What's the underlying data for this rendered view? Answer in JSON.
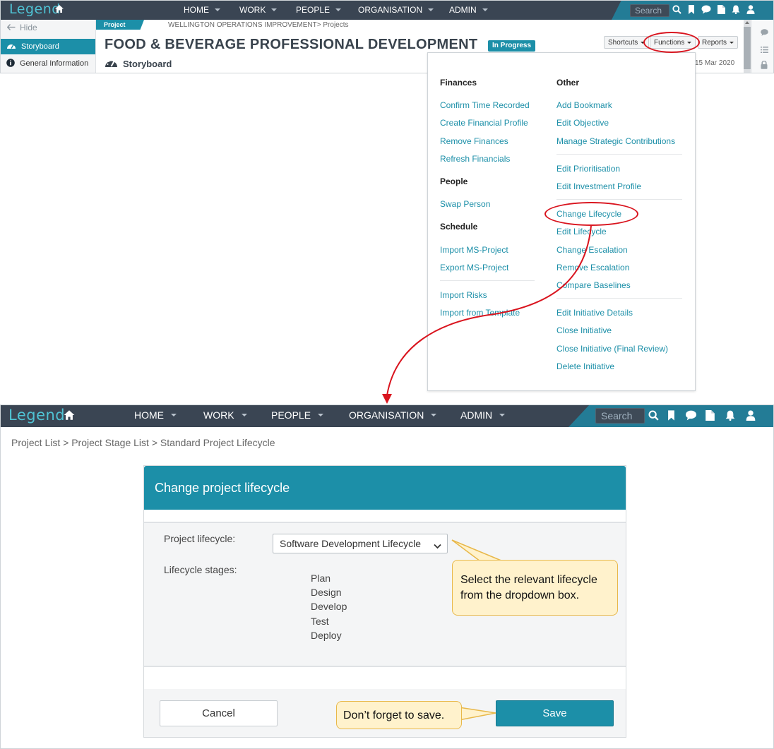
{
  "nav_top": {
    "logo": "Legend",
    "menu": [
      {
        "label": "HOME"
      },
      {
        "label": "WORK"
      },
      {
        "label": "PEOPLE"
      },
      {
        "label": "ORGANISATION"
      },
      {
        "label": "ADMIN"
      }
    ],
    "search_placeholder": "Search"
  },
  "sidebar": {
    "hide_label": "Hide",
    "items": [
      {
        "label": "Storyboard",
        "active": true
      },
      {
        "label": "General Information",
        "active": false
      }
    ]
  },
  "header": {
    "tag": "Project",
    "breadcrumb": "WELLINGTON OPERATIONS IMPROVEMENT> Projects",
    "title": "FOOD & BEVERAGE PROFESSIONAL DEVELOPMENT",
    "status": "In Progress",
    "subtitle": "Storyboard",
    "buttons": {
      "shortcuts": "Shortcuts",
      "functions": "Functions",
      "reports": "Reports"
    },
    "date": "15 Mar 2020"
  },
  "functions_menu": {
    "col_left": {
      "finances_heading": "Finances",
      "finances": [
        "Confirm Time Recorded",
        "Create Financial Profile",
        "Remove Finances",
        "Refresh Financials"
      ],
      "people_heading": "People",
      "people": [
        "Swap Person"
      ],
      "schedule_heading": "Schedule",
      "schedule": [
        "Import MS-Project",
        "Export MS-Project"
      ],
      "misc": [
        "Import Risks",
        "Import from Template"
      ]
    },
    "col_right": {
      "other_heading": "Other",
      "group1": [
        "Add Bookmark",
        "Edit Objective",
        "Manage Strategic Contributions"
      ],
      "group2": [
        "Edit Prioritisation",
        "Edit Investment Profile"
      ],
      "group3": [
        "Change Lifecycle",
        "Edit Lifecycle",
        "Change Escalation",
        "Remove Escalation",
        "Compare Baselines"
      ],
      "group4": [
        "Edit Initiative Details",
        "Close Initiative",
        "Close Initiative (Final Review)",
        "Delete Initiative"
      ]
    }
  },
  "nav_bottom": {
    "logo": "Legend",
    "menu": [
      {
        "label": "HOME"
      },
      {
        "label": "WORK"
      },
      {
        "label": "PEOPLE"
      },
      {
        "label": "ORGANISATION"
      },
      {
        "label": "ADMIN"
      }
    ],
    "search_placeholder": "Search"
  },
  "lower": {
    "breadcrumb": "Project List > Project Stage List > Standard Project Lifecycle",
    "modal_title": "Change project lifecycle",
    "lifecycle_label": "Project lifecycle:",
    "lifecycle_value": "Software Development Lifecycle",
    "stages_label": "Lifecycle stages:",
    "stages": [
      "Plan",
      "Design",
      "Develop",
      "Test",
      "Deploy"
    ],
    "cancel_label": "Cancel",
    "save_label": "Save"
  },
  "callouts": {
    "select": "Select the relevant lifecycle from the dropdown box.",
    "save": "Don’t forget to save."
  },
  "colors": {
    "navbar": "#3a4553",
    "teal": "#1c8fa8",
    "highlight_red": "#d9141e",
    "callout_fill": "#fff2cc",
    "callout_border": "#e8b84a"
  }
}
